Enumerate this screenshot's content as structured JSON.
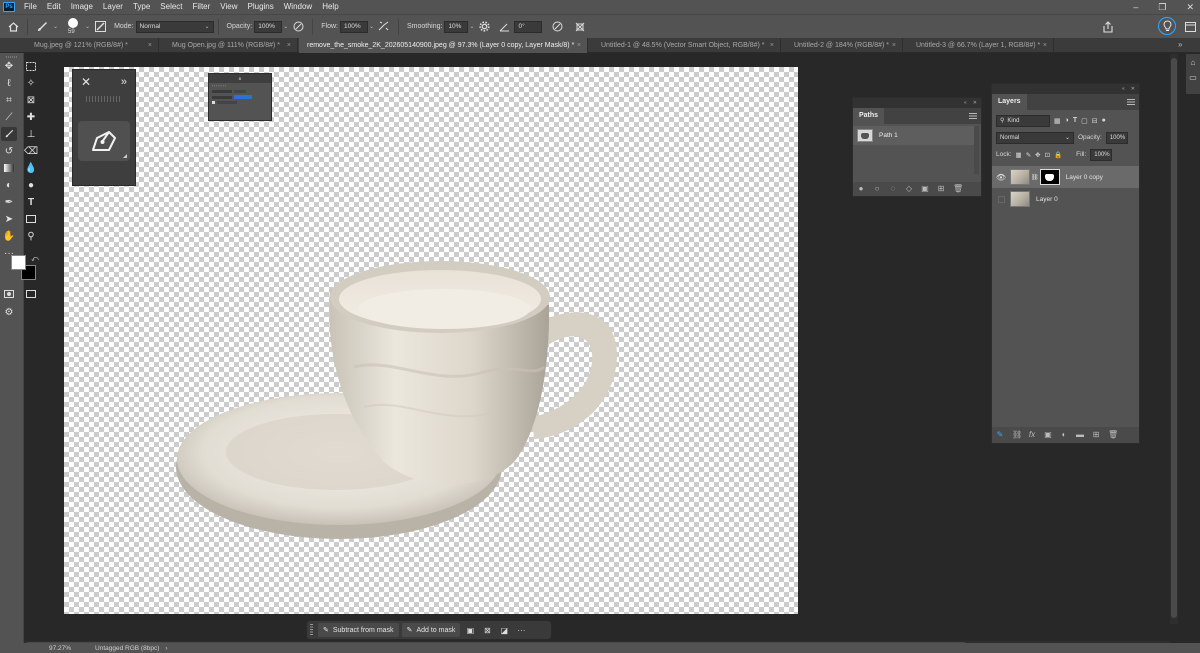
{
  "menu": {
    "logo": "Ps",
    "items": [
      "File",
      "Edit",
      "Image",
      "Layer",
      "Type",
      "Select",
      "Filter",
      "View",
      "Plugins",
      "Window",
      "Help"
    ]
  },
  "window_controls": [
    "–",
    "❐",
    "✕"
  ],
  "options": {
    "brush_size": "59",
    "mode_label": "Mode:",
    "mode_value": "Normal",
    "opacity_label": "Opacity:",
    "opacity_value": "100%",
    "flow_label": "Flow:",
    "flow_value": "100%",
    "smoothing_label": "Smoothing:",
    "smoothing_value": "10%",
    "angle_value": "0°"
  },
  "tabs": [
    {
      "label": "Mug.jpeg @ 121% (RGB/8#) *",
      "close": "×",
      "active": false
    },
    {
      "label": "Mug Open.jpg @ 111% (RGB/8#) *",
      "close": "×",
      "active": false
    },
    {
      "label": "remove_the_smoke_2K_202605140900.jpeg @ 97.3% (Layer 0 copy, Layer Mask/8) *",
      "close": "×",
      "active": true
    },
    {
      "label": "Untitled-1 @ 48.5% (Vector Smart Object, RGB/8#) *",
      "close": "×",
      "active": false
    },
    {
      "label": "Untitled-2 @ 184% (RGB/8#) *",
      "close": "×",
      "active": false
    },
    {
      "label": "Untitled-3 @ 66.7% (Layer 1, RGB/8#) *",
      "close": "×",
      "active": false
    }
  ],
  "paths_panel": {
    "title": "Paths",
    "items": [
      {
        "name": "Path 1"
      }
    ]
  },
  "layers_panel": {
    "title": "Layers",
    "filter_value": "Kind",
    "blend_mode": "Normal",
    "opacity_label": "Opacity:",
    "opacity_value": "100%",
    "lock_label": "Lock:",
    "fill_label": "Fill:",
    "fill_value": "100%",
    "layers": [
      {
        "name": "Layer 0 copy",
        "visible": true,
        "selected": true,
        "has_mask": true
      },
      {
        "name": "Layer 0",
        "visible": false,
        "selected": false,
        "has_mask": false
      }
    ]
  },
  "taskbar": {
    "subtract_label": "Subtract from mask",
    "add_label": "Add to mask",
    "more": "···"
  },
  "status": {
    "zoom": "97.27%",
    "profile": "Untagged RGB (8bpc)"
  },
  "colors": {
    "foreground": "#ffffff",
    "background": "#000000",
    "accent": "#31a8ff"
  }
}
